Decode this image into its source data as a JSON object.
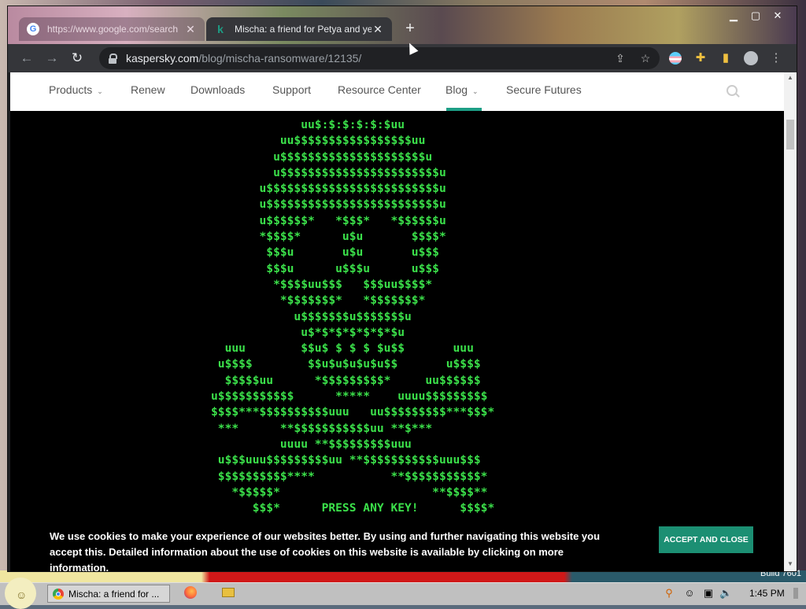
{
  "browser": {
    "tabs": [
      {
        "title": "https://www.google.com/search",
        "favicon": "G",
        "active": false
      },
      {
        "title": "Mischa: a friend for Petya and yet",
        "favicon": "k",
        "active": true
      }
    ],
    "url_host": "kaspersky.com",
    "url_path": "/blog/mischa-ransomware/12135/"
  },
  "site_nav": {
    "items": [
      "Products",
      "Renew",
      "Downloads",
      "Support",
      "Resource Center",
      "Blog",
      "Secure Futures"
    ]
  },
  "ascii_art": [
    "             uu$:$:$:$:$:$uu",
    "          uu$$$$$$$$$$$$$$$$$uu",
    "         u$$$$$$$$$$$$$$$$$$$$$u",
    "         u$$$$$$$$$$$$$$$$$$$$$$$u",
    "       u$$$$$$$$$$$$$$$$$$$$$$$$$u",
    "       u$$$$$$$$$$$$$$$$$$$$$$$$$u",
    "       u$$$$$$*   *$$$*   *$$$$$$u",
    "       *$$$$*      u$u       $$$$*",
    "        $$$u       u$u       u$$$",
    "        $$$u      u$$$u      u$$$",
    "         *$$$$uu$$$   $$$uu$$$$*",
    "          *$$$$$$$*   *$$$$$$$*",
    "            u$$$$$$$u$$$$$$$u",
    "             u$*$*$*$*$*$*$u",
    "  uuu        $$u$ $ $ $ $u$$       uuu",
    " u$$$$        $$u$u$u$u$u$$       u$$$$",
    "  $$$$$uu      *$$$$$$$$$*     uu$$$$$$",
    "u$$$$$$$$$$$      *****    uuuu$$$$$$$$$",
    "$$$$***$$$$$$$$$$uuu   uu$$$$$$$$$***$$$*",
    " ***      **$$$$$$$$$$$uu **$***",
    "          uuuu **$$$$$$$$$uuu",
    " u$$$uuu$$$$$$$$$uu **$$$$$$$$$$$uuu$$$",
    " $$$$$$$$$$****           **$$$$$$$$$$$*",
    "   *$$$$$*                      **$$$$**",
    "      $$$*      PRESS ANY KEY!      $$$$*"
  ],
  "cookie_banner": {
    "text": "We use cookies to make your experience of our websites better. By using and further navigating this website you accept this. Detailed information about the use of cookies on this website is available by clicking on more information.",
    "button": "ACCEPT AND CLOSE"
  },
  "taskbar": {
    "task_label": "Mischa: a friend for ...",
    "clock": "1:45 PM",
    "build": "Build 7601"
  },
  "colors": {
    "ascii_green": "#3be04a",
    "accent_teal": "#1c8f73"
  }
}
